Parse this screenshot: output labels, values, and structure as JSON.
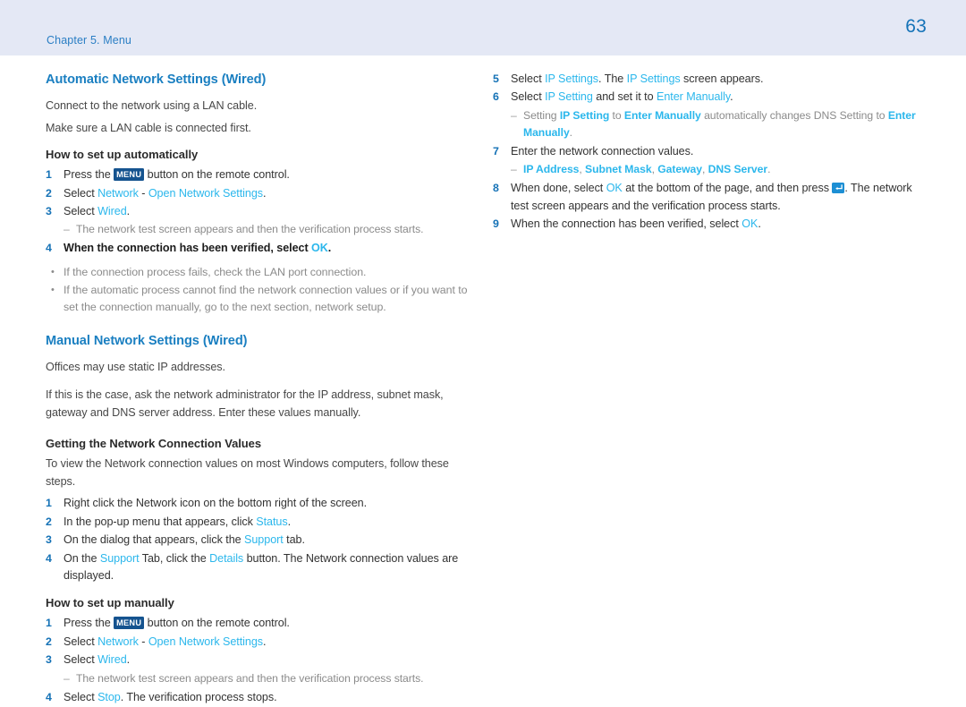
{
  "header": {
    "chapter": "Chapter 5. Menu",
    "page_number": "63"
  },
  "colors": {
    "header_band": "#e4e8f5",
    "chapter_text": "#2a7ec4",
    "page_number": "#1573b8",
    "section_heading": "#1a7fc1",
    "ui_term": "#2bb7ec",
    "step_number": "#1572b6",
    "body_text": "#474747",
    "note_text": "#8b8b8b",
    "key_badge_bg": "#15538f",
    "enter_icon_bg": "#1d8fd4"
  },
  "left_column": {
    "section1": {
      "heading": "Automatic Network Settings (Wired)",
      "para1": "Connect to the network using a LAN cable.",
      "para2": "Make sure a LAN cable is connected first.",
      "subheading": "How to set up automatically",
      "step1": {
        "num": "1",
        "text_before": "Press the ",
        "key": "MENU",
        "text_after": " button on the remote control."
      },
      "step2": {
        "num": "2",
        "text_before": "Select ",
        "term1": "Network",
        "sep": " - ",
        "term2": "Open Network Settings",
        "text_after": "."
      },
      "step3": {
        "num": "3",
        "text_before": "Select ",
        "term1": "Wired",
        "text_after": "."
      },
      "note1": "The network test screen appears and then the verification process starts.",
      "step4": {
        "num": "4",
        "text_before": "When the connection has been verified, select ",
        "term1": "OK",
        "text_after": "."
      },
      "bullet1": "If the connection process fails, check the LAN port connection.",
      "bullet2": "If the automatic process cannot find the network connection values or if you want to set the connection manually, go to the next section, network setup."
    },
    "section2": {
      "heading": "Manual Network Settings (Wired)",
      "para1": "Offices may use static IP addresses.",
      "para2": "If this is the case, ask the network administrator for the IP address, subnet mask, gateway and DNS server address. Enter these values manually.",
      "subheading1": "Getting the Network Connection Values",
      "para3": "To view the Network connection values on most Windows computers, follow these steps.",
      "step1": {
        "num": "1",
        "text_before": "Right click the Network icon on the bottom right of the screen."
      },
      "step2": {
        "num": "2",
        "text_before": "In the pop-up menu that appears, click ",
        "term1": "Status",
        "text_after": "."
      },
      "step3": {
        "num": "3",
        "text_before": "On the dialog that appears, click the ",
        "term1": "Support",
        "text_after": " tab."
      },
      "step4": {
        "num": "4",
        "text_before": "On the ",
        "term1": "Support",
        "text_mid": " Tab, click the ",
        "term2": "Details",
        "text_after": " button. The Network connection values are displayed."
      },
      "subheading2": "How to set up manually",
      "mstep1": {
        "num": "1",
        "text_before": "Press the ",
        "key": "MENU",
        "text_after": " button on the remote control."
      },
      "mstep2": {
        "num": "2",
        "text_before": "Select ",
        "term1": "Network",
        "sep": " - ",
        "term2": "Open Network Settings",
        "text_after": "."
      },
      "mstep3": {
        "num": "3",
        "text_before": "Select ",
        "term1": "Wired",
        "text_after": "."
      },
      "note1": "The network test screen appears and then the verification process starts.",
      "mstep4": {
        "num": "4",
        "text_before": "Select ",
        "term1": "Stop",
        "text_after": ". The verification process stops."
      }
    }
  },
  "right_column": {
    "step5": {
      "num": "5",
      "text_before": "Select ",
      "term1": "IP Settings",
      "text_mid": ". The ",
      "term2": "IP Settings",
      "text_after": " screen appears."
    },
    "step6": {
      "num": "6",
      "text_before": "Select ",
      "term1": "IP Setting",
      "text_mid": " and set it to ",
      "term2": "Enter Manually",
      "text_after": "."
    },
    "note1": {
      "text_before": "Setting ",
      "term1": "IP Setting",
      "text_mid1": " to ",
      "term2": "Enter Manually",
      "text_mid2": " automatically changes DNS Setting to ",
      "term3": "Enter Manually",
      "text_after": "."
    },
    "step7": {
      "num": "7",
      "text_before": "Enter the network connection values."
    },
    "note2": {
      "term1": "IP Address",
      "sep1": ", ",
      "term2": "Subnet Mask",
      "sep2": ", ",
      "term3": "Gateway",
      "sep3": ", ",
      "term4": "DNS Server",
      "text_after": "."
    },
    "step8": {
      "num": "8",
      "text_before": "When done, select ",
      "term1": "OK",
      "text_mid": " at the bottom of the page, and then press ",
      "icon": "enter-key-icon",
      "text_after": ". The network test screen appears and the verification process starts."
    },
    "step9": {
      "num": "9",
      "text_before": "When the connection has been verified, select ",
      "term1": "OK",
      "text_after": "."
    }
  }
}
